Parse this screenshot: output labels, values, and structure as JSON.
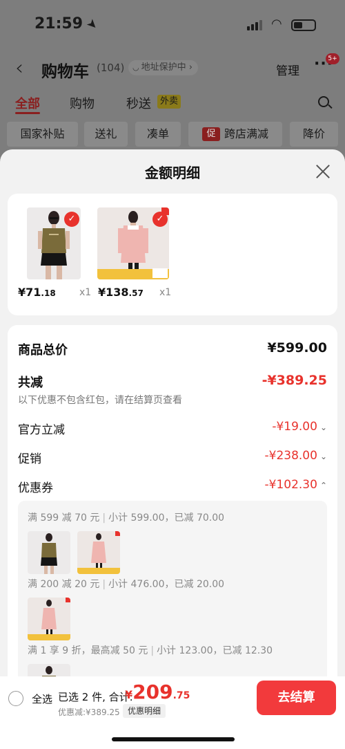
{
  "status_bar": {
    "time": "21:59"
  },
  "header": {
    "title": "购物车",
    "count": "(104)",
    "address_protect": "地址保护中",
    "manage": "管理",
    "more_badge": "5+"
  },
  "tabs": [
    {
      "label": "全部"
    },
    {
      "label": "购物"
    },
    {
      "label": "秒送"
    }
  ],
  "tab_badge": "外卖",
  "filters": [
    {
      "label": "国家补贴"
    },
    {
      "label": "送礼"
    },
    {
      "label": "凑单"
    },
    {
      "label": "跨店满减",
      "icon_text": "促"
    },
    {
      "label": "降价"
    }
  ],
  "sheet": {
    "title": "金额明细",
    "products": [
      {
        "price_int": "¥71",
        "price_dec": ".18",
        "qty": "x1"
      },
      {
        "price_int": "¥138",
        "price_dec": ".57",
        "qty": "x1"
      }
    ],
    "summary": {
      "total_label": "商品总价",
      "total_value": "¥599.00",
      "reduce_label": "共减",
      "reduce_value": "-¥389.25",
      "note": "以下优惠不包含红包，请在结算页查看",
      "official_label": "官方立减",
      "official_value": "-¥19.00",
      "promo_label": "促销",
      "promo_value": "-¥238.00",
      "coupon_label": "优惠券",
      "coupon_value": "-¥102.30"
    },
    "coupons": [
      {
        "rule": "满 599 减 70 元",
        "detail": "小计 599.00，已减 70.00"
      },
      {
        "rule": "满 200 减 20 元",
        "detail": "小计 476.00，已减 20.00"
      },
      {
        "rule": "满 1 享 9 折，最高减 50 元",
        "detail": "小计 123.00，已减 12.30"
      }
    ]
  },
  "bottom_bar": {
    "select_all": "全选",
    "selected": "已选 2 件, 合计:",
    "total_currency": "¥",
    "total_int": "209",
    "total_dec": ".75",
    "discount": "优惠减:¥389.25",
    "detail_link": "优惠明细",
    "checkout": "去结算"
  },
  "colors": {
    "accent_red": "#e8322c",
    "button_red": "#f23a3c"
  }
}
